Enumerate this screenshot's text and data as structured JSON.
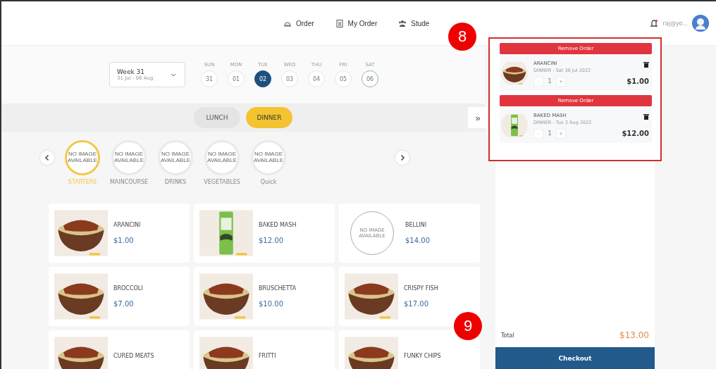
{
  "nav": [
    {
      "label": "Order"
    },
    {
      "label": "My Order"
    },
    {
      "label": "Stude"
    }
  ],
  "user": {
    "email": "raj@yo..."
  },
  "week": {
    "title": "Week 31",
    "range": "31 Jul - 06 Aug"
  },
  "days": [
    {
      "name": "SUN",
      "date": "31",
      "selected": false,
      "today": false
    },
    {
      "name": "MON",
      "date": "01",
      "selected": false,
      "today": false
    },
    {
      "name": "TUE",
      "date": "02",
      "selected": true,
      "today": false
    },
    {
      "name": "WED",
      "date": "03",
      "selected": false,
      "today": false
    },
    {
      "name": "THU",
      "date": "04",
      "selected": false,
      "today": false
    },
    {
      "name": "FRI",
      "date": "05",
      "selected": false,
      "today": false
    },
    {
      "name": "SAT",
      "date": "06",
      "selected": false,
      "today": true
    }
  ],
  "meals": [
    {
      "label": "LUNCH",
      "selected": false
    },
    {
      "label": "DINNER",
      "selected": true
    }
  ],
  "collapse_button": "»",
  "categories": [
    {
      "label": "STARTERS",
      "image_text": "NO IMAGE AVAILABLE",
      "selected": true
    },
    {
      "label": "MAINCOURSE",
      "image_text": "NO IMAGE AVAILABLE",
      "selected": false
    },
    {
      "label": "DRINKS",
      "image_text": "NO IMAGE AVAILABLE",
      "selected": false
    },
    {
      "label": "VEGETABLES",
      "image_text": "NO IMAGE AVAILABLE",
      "selected": false
    },
    {
      "label": "Quick",
      "image_text": "NO IMAGE AVAILABLE",
      "selected": false
    }
  ],
  "menu": [
    {
      "name": "ARANCINI",
      "price": "$1.00",
      "kind": "bowl"
    },
    {
      "name": "BAKED MASH",
      "price": "$12.00",
      "kind": "can"
    },
    {
      "name": "BELLINI",
      "price": "$14.00",
      "kind": "placeholder",
      "image_text": "NO IMAGE AVAILABLE"
    },
    {
      "name": "BROCCOLI",
      "price": "$7.00",
      "kind": "bowl"
    },
    {
      "name": "BRUSCHETTA",
      "price": "$10.00",
      "kind": "bowl"
    },
    {
      "name": "CRISPY FISH",
      "price": "$17.00",
      "kind": "bowl"
    },
    {
      "name": "CURED MEATS",
      "kind": "bowl"
    },
    {
      "name": "FRITTI",
      "kind": "bowl"
    },
    {
      "name": "FUNKY CHIPS",
      "kind": "bowl"
    }
  ],
  "cart": {
    "items": [
      {
        "remove_label": "Remove Order",
        "name": "ARANCINI",
        "detail": "DINNER - Sat 30 Jul 2022",
        "minus": "-",
        "quantity": "1",
        "plus": "+",
        "price": "$1.00",
        "kind": "bowl"
      },
      {
        "remove_label": "Remove Order",
        "name": "BAKED MASH",
        "detail": "DINNER - Tue 2 Aug 2022",
        "minus": "-",
        "quantity": "1",
        "plus": "+",
        "price": "$12.00",
        "kind": "can"
      }
    ],
    "total_label": "Total",
    "total": "$13.00",
    "checkout": "Checkout"
  },
  "callouts": [
    "8",
    "9"
  ]
}
